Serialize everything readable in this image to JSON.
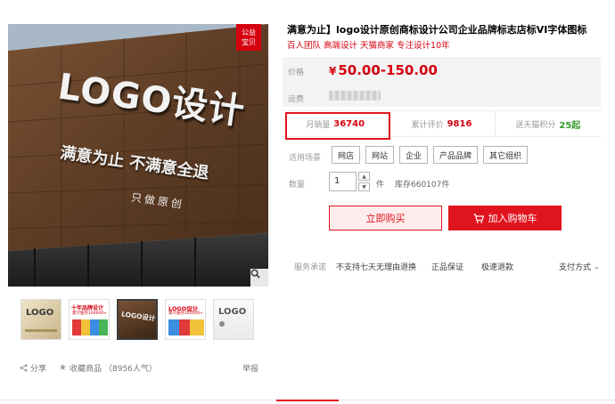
{
  "main_image": {
    "badge": [
      "公益",
      "宝贝"
    ],
    "sign_text": "LOGO设计",
    "slogan": "满意为止 不满意全退",
    "tagline": "只做原创"
  },
  "thumbnails": [
    {
      "label": "LOGO",
      "note": "",
      "active": false
    },
    {
      "label": "十年品牌设计",
      "note": "累计服务160000+",
      "active": false
    },
    {
      "label": "LOGO设计",
      "note": "",
      "active": true
    },
    {
      "label": "LOGO设计",
      "note": "累计服务160000+",
      "active": false
    },
    {
      "label": "LOGO",
      "note": "",
      "active": false
    }
  ],
  "share_bar": {
    "share": "分享",
    "favorite": "收藏商品",
    "favorite_count": "（8956人气）",
    "report": "举报"
  },
  "product": {
    "title": "满意为止】logo设计原创商标设计公司企业品牌标志店标VI字体图标",
    "subtitle": "百人团队 高端设计 天猫商家 专注设计10年"
  },
  "price": {
    "label": "价格",
    "currency": "¥",
    "value": "50.00-150.00",
    "shipping_label": "运费"
  },
  "stats": {
    "sales_label": "月销量",
    "sales_value": "36740",
    "reviews_label": "累计评价",
    "reviews_value": "9816",
    "points_label": "送天猫积分",
    "points_value": "25起"
  },
  "scenes": {
    "label": "适用场景",
    "options": [
      "网店",
      "网站",
      "企业",
      "产品品牌",
      "其它组织"
    ]
  },
  "quantity": {
    "label": "数量",
    "value": "1",
    "unit": "件",
    "stock": "库存660107件"
  },
  "buttons": {
    "buy_now": "立即购买",
    "add_cart": "加入购物车"
  },
  "service": {
    "label": "服务承诺",
    "items": [
      "不支持七天无理由退换",
      "正品保证",
      "极速退款"
    ],
    "payment": "支付方式"
  },
  "colors": {
    "brand_red": "#e0141e",
    "price_red": "#d5000f",
    "points_green": "#3b9b2f"
  }
}
